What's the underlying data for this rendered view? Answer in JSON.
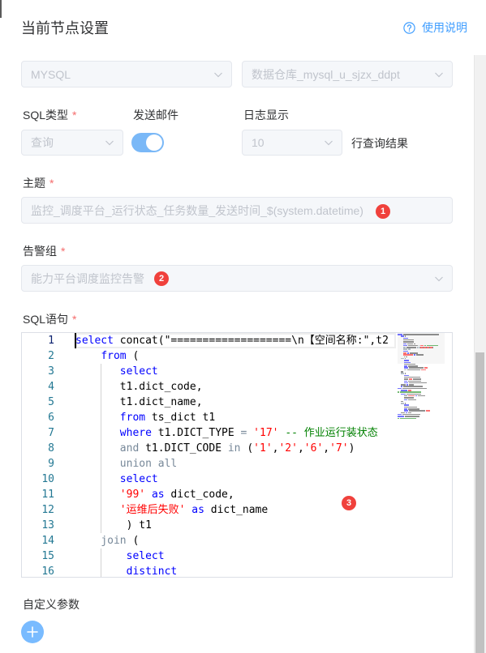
{
  "header": {
    "title": "当前节点设置",
    "help_label": "使用说明"
  },
  "datasource": {
    "type": {
      "value": "MYSQL"
    },
    "instance": {
      "value": "数据仓库_mysql_u_sjzx_ddpt"
    }
  },
  "sql_type": {
    "label": "SQL类型",
    "required_mark": "*",
    "value": "查询"
  },
  "send_email": {
    "label": "发送邮件",
    "checked": true
  },
  "log_display": {
    "label": "日志显示",
    "value": "10",
    "suffix": "行查询结果"
  },
  "subject": {
    "label": "主题",
    "required_mark": "*",
    "value": "监控_调度平台_运行状态_任务数量_发送时间_$(system.datetime)",
    "badge": "1"
  },
  "alert_group": {
    "label": "告警组",
    "required_mark": "*",
    "value": "能力平台调度监控告警",
    "badge": "2"
  },
  "sql": {
    "label": "SQL语句",
    "required_mark": "*",
    "badge": "3",
    "lines": [
      {
        "n": 1,
        "tokens": [
          {
            "keyword": "select"
          },
          {
            "text": " concat(\"===================\\n【空间名称:\",t2"
          }
        ]
      },
      {
        "n": 2,
        "tokens": [
          {
            "text": "    "
          },
          {
            "keyword": "from"
          },
          {
            "text": " ("
          }
        ]
      },
      {
        "n": 3,
        "tokens": [
          {
            "text": "       "
          },
          {
            "keyword": "select"
          }
        ]
      },
      {
        "n": 4,
        "tokens": [
          {
            "text": "       t1.dict_code,"
          }
        ]
      },
      {
        "n": 5,
        "tokens": [
          {
            "text": "       t1.dict_name,"
          }
        ]
      },
      {
        "n": 6,
        "tokens": [
          {
            "text": "       "
          },
          {
            "keyword": "from"
          },
          {
            "text": " ts_dict t1"
          }
        ]
      },
      {
        "n": 7,
        "tokens": [
          {
            "text": "       "
          },
          {
            "keyword": "where"
          },
          {
            "text": " t1.DICT_TYPE "
          },
          {
            "operator": "="
          },
          {
            "text": " "
          },
          {
            "string": "'17'"
          },
          {
            "text": " "
          },
          {
            "comment": "-- 作业运行装状态"
          }
        ]
      },
      {
        "n": 8,
        "tokens": [
          {
            "text": "       "
          },
          {
            "operator": "and"
          },
          {
            "text": " t1.DICT_CODE "
          },
          {
            "operator": "in"
          },
          {
            "text": " ("
          },
          {
            "string": "'1'"
          },
          {
            "text": ","
          },
          {
            "string": "'2'"
          },
          {
            "text": ","
          },
          {
            "string": "'6'"
          },
          {
            "text": ","
          },
          {
            "string": "'7'"
          },
          {
            "text": ")"
          }
        ]
      },
      {
        "n": 9,
        "tokens": [
          {
            "text": "       "
          },
          {
            "operator": "union all"
          }
        ]
      },
      {
        "n": 10,
        "tokens": [
          {
            "text": "       "
          },
          {
            "keyword": "select"
          }
        ]
      },
      {
        "n": 11,
        "tokens": [
          {
            "text": "       "
          },
          {
            "string": "'99'"
          },
          {
            "text": " "
          },
          {
            "keyword": "as"
          },
          {
            "text": " dict_code,"
          }
        ]
      },
      {
        "n": 12,
        "tokens": [
          {
            "text": "       "
          },
          {
            "string": "'运维后失败'"
          },
          {
            "text": " "
          },
          {
            "keyword": "as"
          },
          {
            "text": " dict_name"
          }
        ]
      },
      {
        "n": 13,
        "tokens": [
          {
            "text": "        ) t1"
          }
        ]
      },
      {
        "n": 14,
        "tokens": [
          {
            "text": "    "
          },
          {
            "operator": "join"
          },
          {
            "text": " ("
          }
        ]
      },
      {
        "n": 15,
        "tokens": [
          {
            "text": "        "
          },
          {
            "keyword": "select"
          }
        ]
      },
      {
        "n": 16,
        "tokens": [
          {
            "text": "        "
          },
          {
            "keyword": "distinct"
          }
        ]
      }
    ]
  },
  "custom_params": {
    "label": "自定义参数"
  },
  "colors": {
    "primary": "#409eff",
    "danger": "#f56c6c",
    "badge": "#f0413c",
    "toggle_on": "#7ab8f7",
    "add_button": "#79bbff",
    "keyword": "#0000ff",
    "operator": "#778899",
    "string": "#ff0000",
    "comment": "#008000",
    "line_number": "#237893"
  },
  "icons": {
    "help": "question-circle-icon",
    "dropdown": "chevron-down-icon",
    "add": "plus-icon"
  }
}
